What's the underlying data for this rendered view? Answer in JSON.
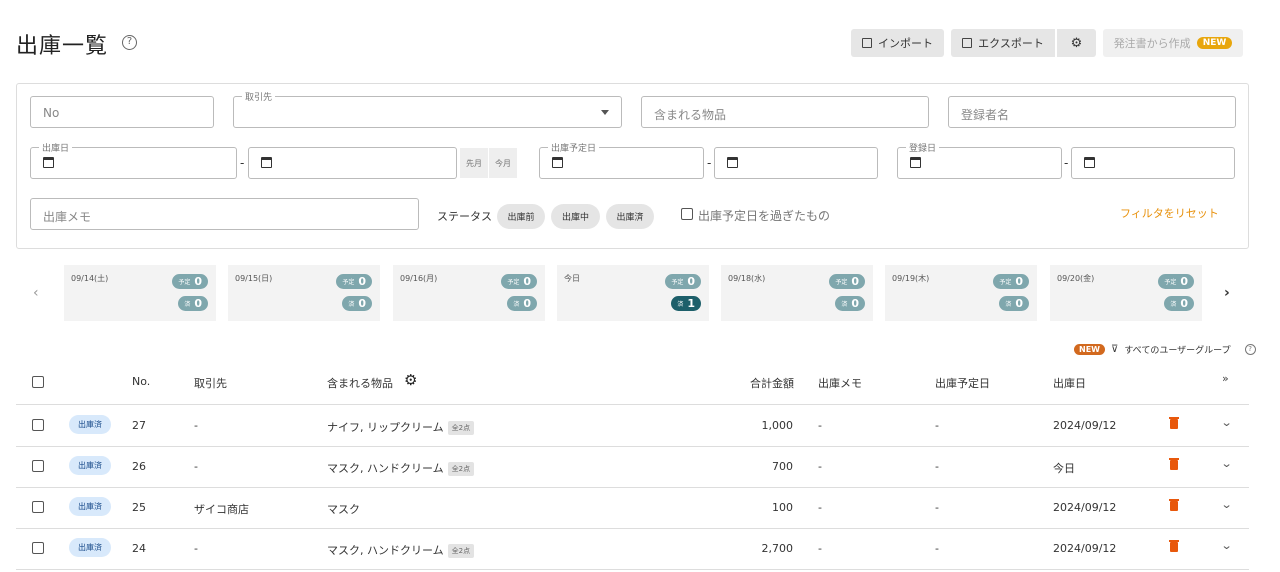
{
  "header": {
    "title": "出庫一覧",
    "import_label": "インポート",
    "export_label": "エクスポート",
    "create_label": "発注書から作成",
    "new_badge": "NEW"
  },
  "filters": {
    "no_placeholder": "No",
    "customer_legend": "取引先",
    "items_placeholder": "含まれる物品",
    "registrant_placeholder": "登録者名",
    "ship_date_legend": "出庫日",
    "prev_month": "先月",
    "this_month": "今月",
    "planned_date_legend": "出庫予定日",
    "registered_date_legend": "登録日",
    "memo_placeholder": "出庫メモ",
    "status_label": "ステータス",
    "status_chips": [
      "出庫前",
      "出庫中",
      "出庫済"
    ],
    "overdue_label": "出庫予定日を過ぎたもの",
    "reset_label": "フィルタをリセット",
    "dash": "-"
  },
  "calendar": {
    "prev_arrow": "‹",
    "next_arrow": "›",
    "plan_label": "予定",
    "done_label": "済",
    "days": [
      {
        "date": "09/14(土)",
        "plan": "0",
        "done": "0"
      },
      {
        "date": "09/15(日)",
        "plan": "0",
        "done": "0"
      },
      {
        "date": "09/16(月)",
        "plan": "0",
        "done": "0"
      },
      {
        "date": "今日",
        "plan": "0",
        "done": "1"
      },
      {
        "date": "09/18(水)",
        "plan": "0",
        "done": "0"
      },
      {
        "date": "09/19(木)",
        "plan": "0",
        "done": "0"
      },
      {
        "date": "09/20(金)",
        "plan": "0",
        "done": "0"
      }
    ]
  },
  "table": {
    "new_badge": "NEW",
    "group_label": "すべてのユーザーグループ",
    "columns": {
      "no": "No.",
      "customer": "取引先",
      "items": "含まれる物品",
      "total": "合計金額",
      "memo": "出庫メモ",
      "planned": "出庫予定日",
      "shipped": "出庫日"
    },
    "rows": [
      {
        "status": "出庫済",
        "no": "27",
        "customer": "-",
        "items": "ナイフ, リップクリーム",
        "count": "全2点",
        "total": "1,000",
        "memo": "-",
        "planned": "-",
        "shipped": "2024/09/12"
      },
      {
        "status": "出庫済",
        "no": "26",
        "customer": "-",
        "items": "マスク, ハンドクリーム",
        "count": "全2点",
        "total": "700",
        "memo": "-",
        "planned": "-",
        "shipped": "今日"
      },
      {
        "status": "出庫済",
        "no": "25",
        "customer": "ザイコ商店",
        "items": "マスク",
        "count": "",
        "total": "100",
        "memo": "-",
        "planned": "-",
        "shipped": "2024/09/12"
      },
      {
        "status": "出庫済",
        "no": "24",
        "customer": "-",
        "items": "マスク, ハンドクリーム",
        "count": "全2点",
        "total": "2,700",
        "memo": "-",
        "planned": "-",
        "shipped": "2024/09/12"
      }
    ]
  }
}
